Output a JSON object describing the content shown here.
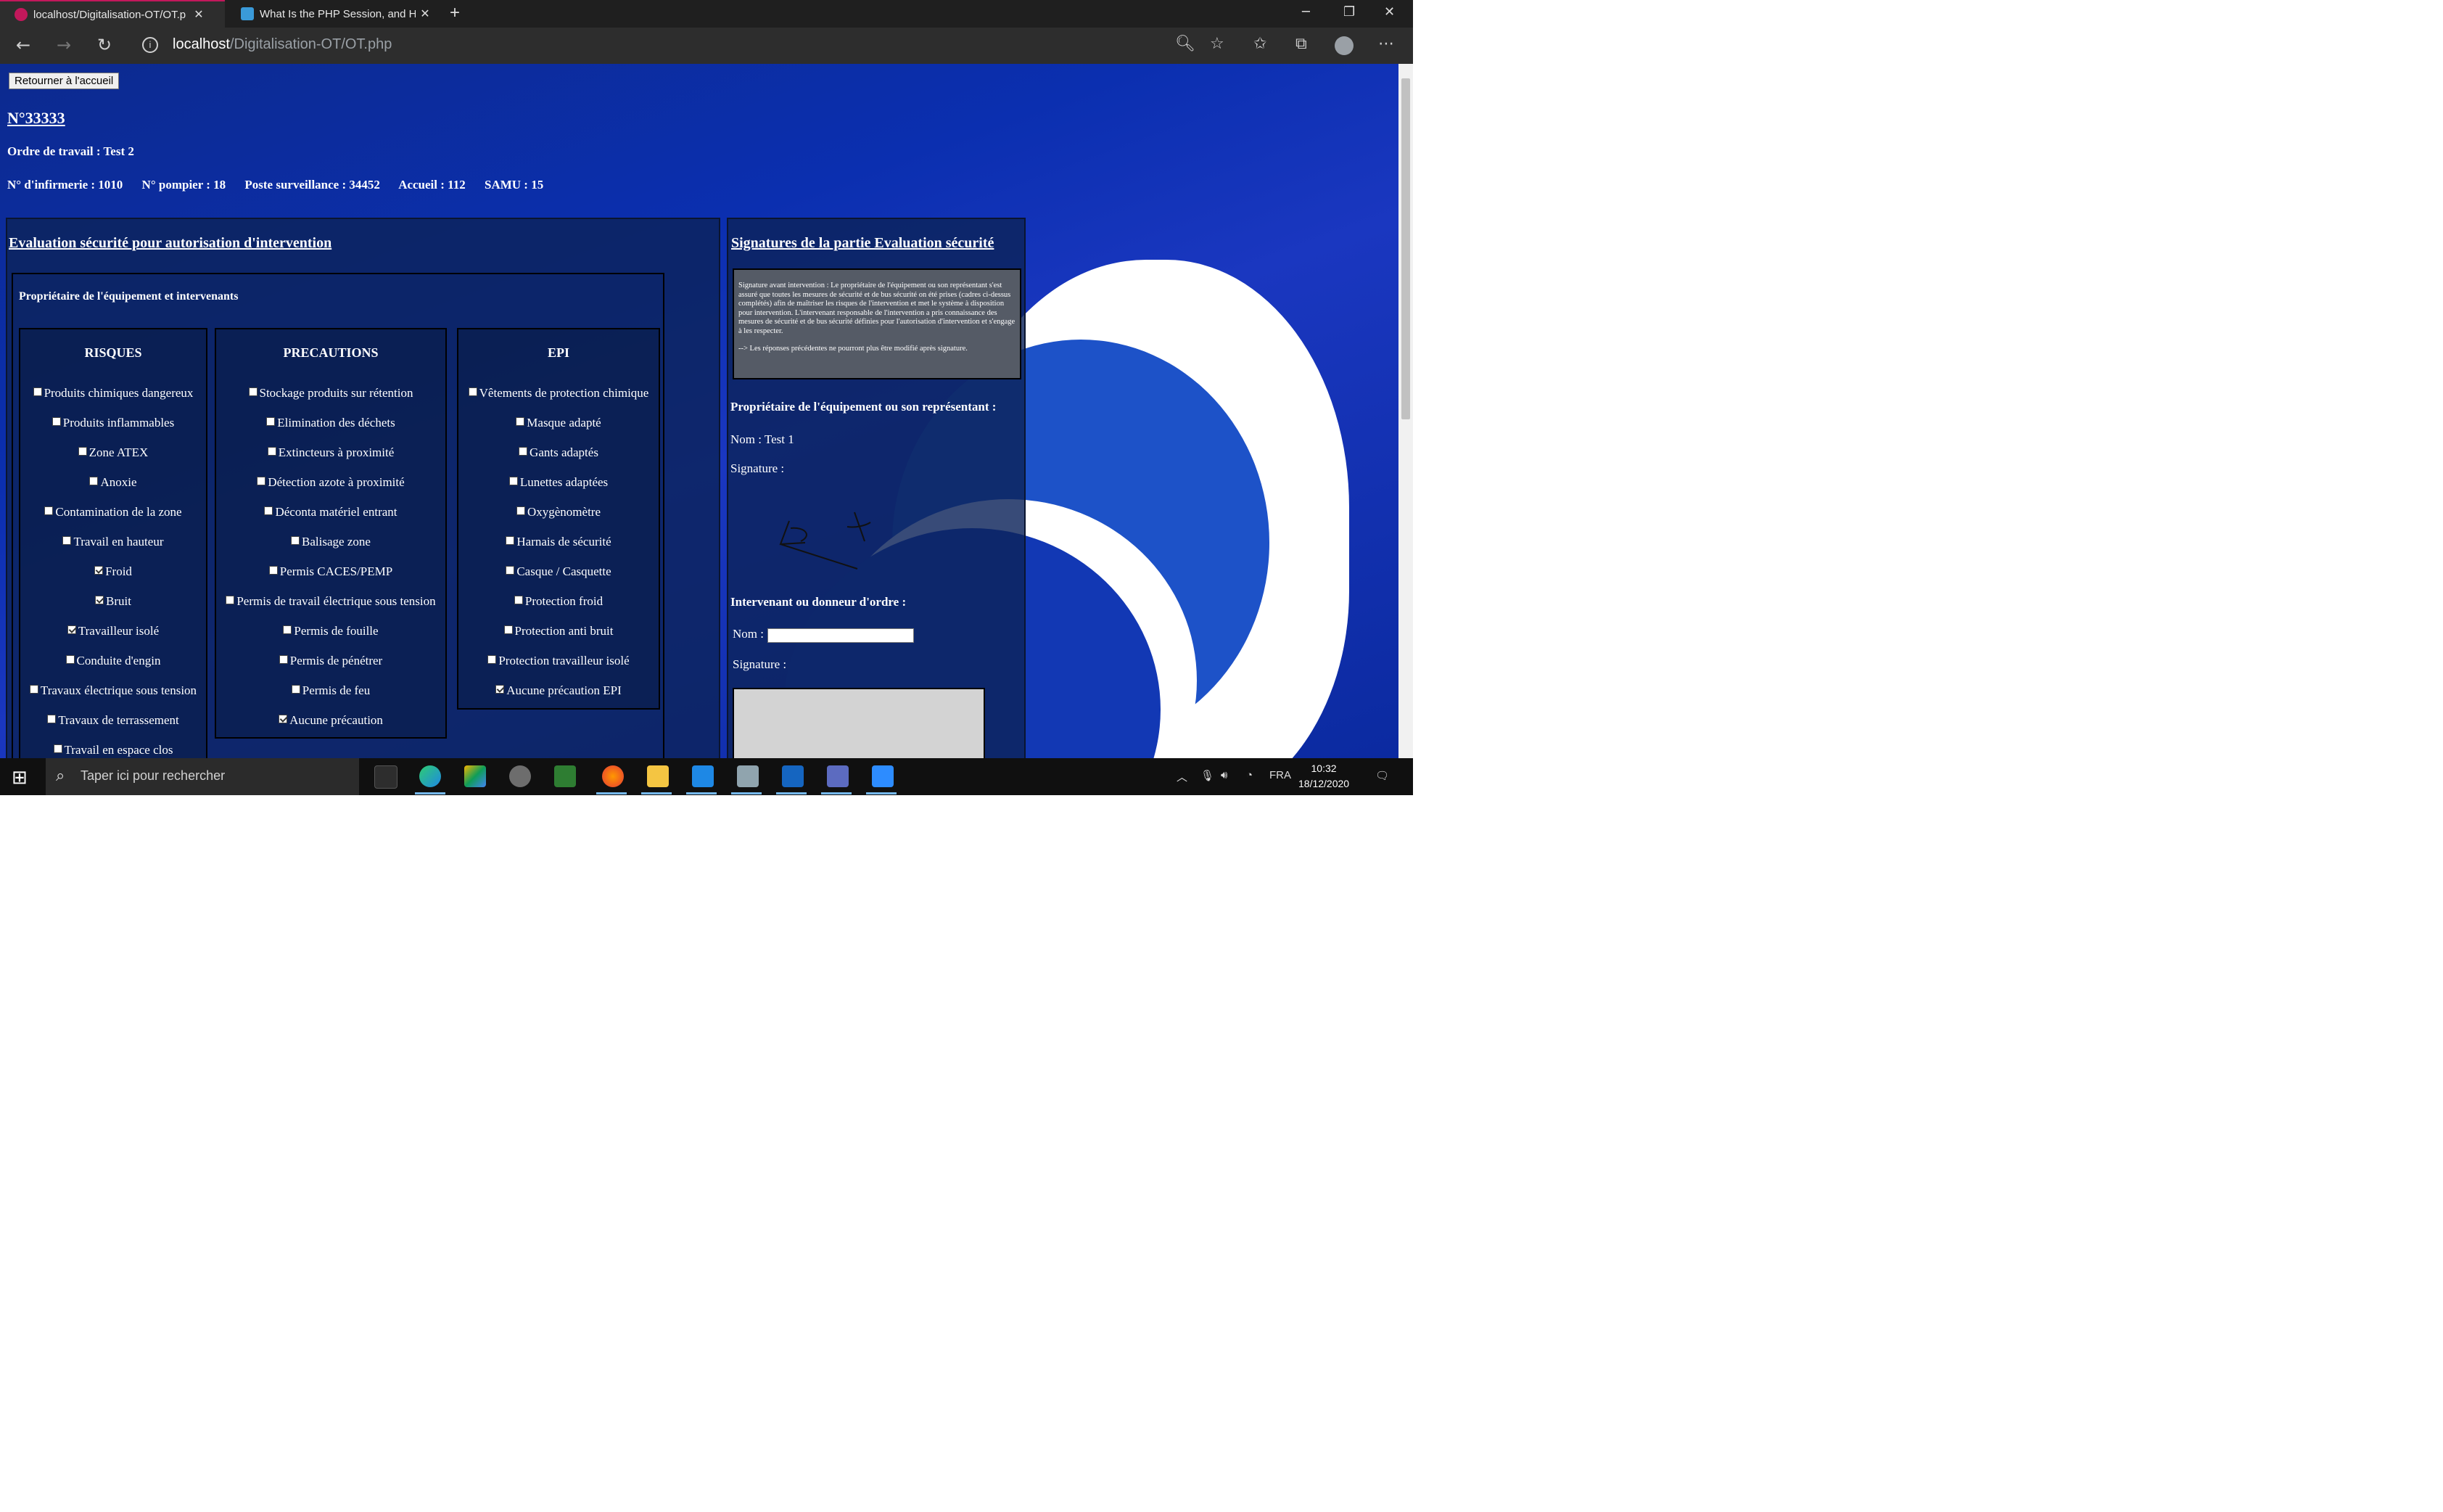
{
  "browser": {
    "tabs": [
      {
        "title": "localhost/Digitalisation-OT/OT.p",
        "active": true
      },
      {
        "title": "What Is the PHP Session, and Ho",
        "active": false
      }
    ],
    "url_host": "localhost",
    "url_path": "/Digitalisation-OT/OT.php"
  },
  "page": {
    "home_button": "Retourner à l'accueil",
    "wo_number": "N°33333",
    "wo_title": "Ordre de travail : Test 2",
    "contacts": [
      "N° d'infirmerie : 1010",
      "N° pompier : 18",
      "Poste surveillance : 34452",
      "Accueil : 112",
      "SAMU : 15"
    ],
    "eval_title": "Evaluation sécurité pour autorisation d'intervention",
    "owner_section": "Propriétaire de l'équipement et intervenants",
    "columns": [
      {
        "header": "RISQUES",
        "items": [
          {
            "label": "Produits chimiques dangereux",
            "checked": false
          },
          {
            "label": "Produits inflammables",
            "checked": false
          },
          {
            "label": "Zone ATEX",
            "checked": false
          },
          {
            "label": "Anoxie",
            "checked": false
          },
          {
            "label": "Contamination de la zone",
            "checked": false
          },
          {
            "label": "Travail en hauteur",
            "checked": false
          },
          {
            "label": "Froid",
            "checked": true
          },
          {
            "label": "Bruit",
            "checked": true
          },
          {
            "label": "Travailleur isolé",
            "checked": true
          },
          {
            "label": "Conduite d'engin",
            "checked": false
          },
          {
            "label": "Travaux électrique sous tension",
            "checked": false
          },
          {
            "label": "Travaux de terrassement",
            "checked": false
          },
          {
            "label": "Travail en espace clos",
            "checked": false
          }
        ]
      },
      {
        "header": "PRECAUTIONS",
        "items": [
          {
            "label": "Stockage produits sur rétention",
            "checked": false
          },
          {
            "label": "Elimination des déchets",
            "checked": false
          },
          {
            "label": "Extincteurs à proximité",
            "checked": false
          },
          {
            "label": "Détection azote à proximité",
            "checked": false
          },
          {
            "label": "Déconta matériel entrant",
            "checked": false
          },
          {
            "label": "Balisage zone",
            "checked": false
          },
          {
            "label": "Permis CACES/PEMP",
            "checked": false
          },
          {
            "label": "Permis de travail électrique sous tension",
            "checked": false
          },
          {
            "label": "Permis de fouille",
            "checked": false
          },
          {
            "label": "Permis de pénétrer",
            "checked": false
          },
          {
            "label": "Permis de feu",
            "checked": false
          },
          {
            "label": "Aucune précaution",
            "checked": true
          }
        ]
      },
      {
        "header": "EPI",
        "items": [
          {
            "label": "Vêtements de protection chimique",
            "checked": false
          },
          {
            "label": "Masque adapté",
            "checked": false
          },
          {
            "label": "Gants adaptés",
            "checked": false
          },
          {
            "label": "Lunettes adaptées",
            "checked": false
          },
          {
            "label": "Oxygènomètre",
            "checked": false
          },
          {
            "label": "Harnais de sécurité",
            "checked": false
          },
          {
            "label": "Casque / Casquette",
            "checked": false
          },
          {
            "label": "Protection froid",
            "checked": false
          },
          {
            "label": "Protection anti bruit",
            "checked": false
          },
          {
            "label": "Protection travailleur isolé",
            "checked": false
          },
          {
            "label": "Aucune précaution EPI",
            "checked": true
          }
        ]
      }
    ],
    "signatures": {
      "title": "Signatures de la partie Evaluation sécurité",
      "notice": "Signature avant intervention : Le propriétaire de l'équipement ou son représentant s'est assuré que toutes les mesures de sécurité et de bus sécurité on été prises (cadres ci-dessus complétés) afin de maîtriser les risques de l'intervention et met le système à disposition pour intervention. L'intervenant responsable de l'intervention a pris connaissance des mesures de sécurité et de bus sécurité définies pour l'autorisation d'intervention et s'engage à les respecter.",
      "notice_note": "--> Les réponses précédentes ne pourront plus être modifié après signature.",
      "owner_heading": "Propriétaire de l'équipement ou son représentant :",
      "owner_name": "Nom : Test 1",
      "signature_label": "Signature :",
      "worker_heading": "Intervenant ou donneur d'ordre :",
      "worker_name_label": "Nom :",
      "worker_signature_label": "Signature :"
    }
  },
  "taskbar": {
    "search_placeholder": "Taper ici pour rechercher",
    "language": "FRA",
    "time": "10:32",
    "date": "18/12/2020"
  }
}
